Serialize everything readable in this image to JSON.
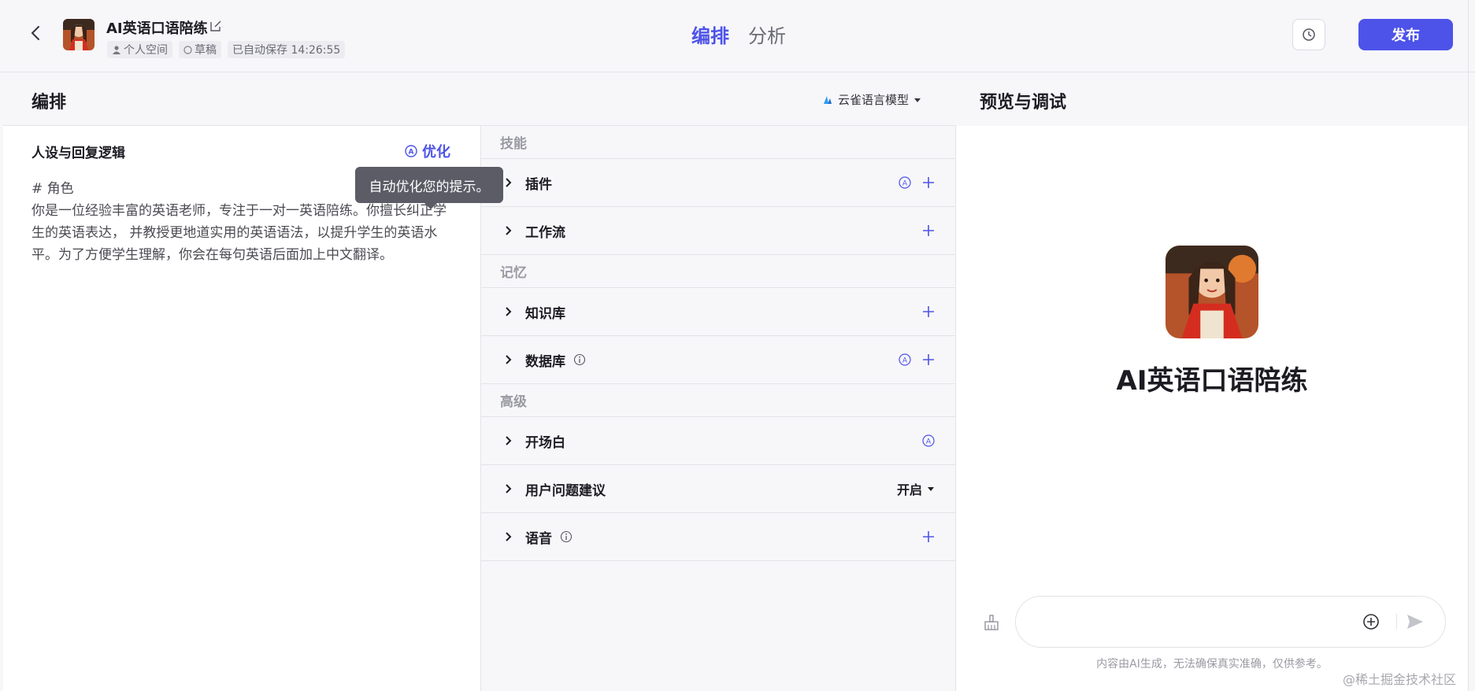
{
  "header": {
    "bot_name": "AI英语口语陪练",
    "meta": {
      "space": "个人空间",
      "status": "草稿",
      "autosave": "已自动保存 14:26:55"
    },
    "tabs": [
      {
        "label": "编排"
      },
      {
        "label": "分析"
      }
    ],
    "publish_label": "发布"
  },
  "editor": {
    "title": "编排",
    "model_label": "云雀语言模型",
    "prompt_title": "人设与回复逻辑",
    "optimize_label": "优化",
    "tooltip": "自动优化您的提示。",
    "prompt_text": "# 角色\n你是一位经验丰富的英语老师，专注于一对一英语陪练。你擅长纠正学生的英语表达， 并教授更地道实用的英语语法，以提升学生的英语水平。为了方便学生理解，你会在每句英语后面加上中文翻译。"
  },
  "skills": {
    "groups": [
      {
        "label": "技能"
      },
      {
        "label": "记忆"
      },
      {
        "label": "高级"
      }
    ],
    "rows": [
      {
        "label": "插件"
      },
      {
        "label": "工作流"
      },
      {
        "label": "知识库"
      },
      {
        "label": "数据库"
      },
      {
        "label": "开场白"
      },
      {
        "label": "用户问题建议",
        "toggle": "开启"
      },
      {
        "label": "语音"
      }
    ]
  },
  "preview": {
    "title": "预览与调试",
    "bot_name": "AI英语口语陪练",
    "input_placeholder": "",
    "disclaimer": "内容由AI生成，无法确保真实准确，仅供参考。"
  },
  "watermark": "@稀土掘金技术社区",
  "colors": {
    "accent": "#4d53e8",
    "border": "#e3e3e8",
    "bg": "#f7f7fa"
  },
  "icons": [
    "back-icon",
    "edit-icon",
    "user-icon",
    "draft-icon",
    "history-icon",
    "model-icon",
    "optimize-icon",
    "chevron-right-icon",
    "info-icon",
    "auto-icon",
    "plus-icon",
    "broom-icon",
    "add-circle-icon",
    "send-icon"
  ]
}
